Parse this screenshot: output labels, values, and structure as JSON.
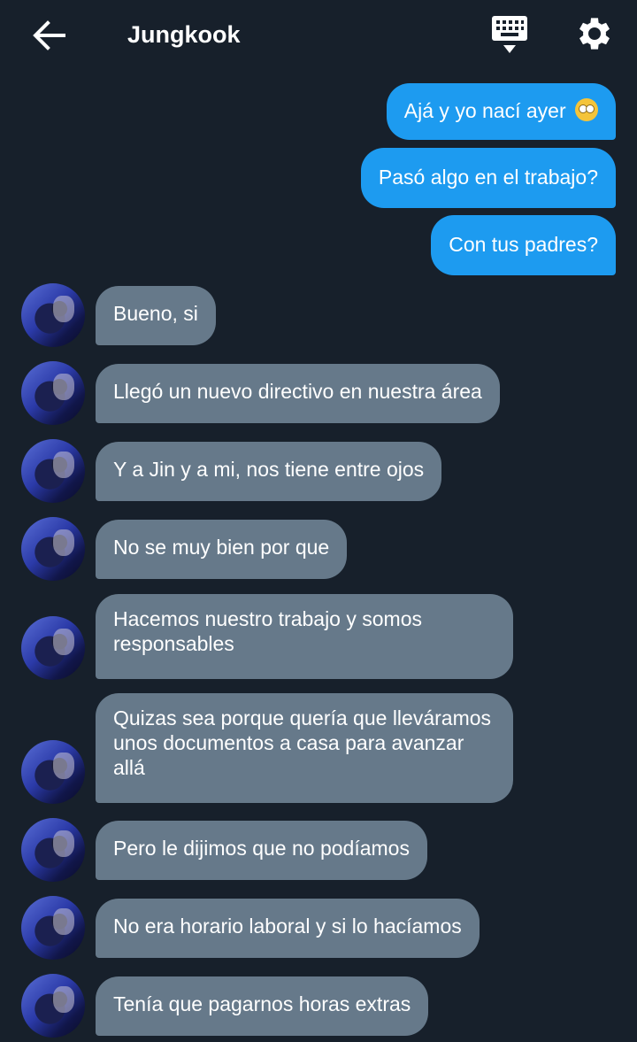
{
  "header": {
    "title": "Jungkook",
    "back_icon": "arrow-left-icon",
    "keyboard_icon": "keyboard-icon",
    "settings_icon": "gear-icon"
  },
  "colors": {
    "background": "#17202b",
    "outgoing_bubble": "#1d9bf0",
    "incoming_bubble": "#66798a"
  },
  "messages_out": [
    {
      "text": "Ajá y yo nací ayer",
      "emoji": "face-with-rolling-eyes"
    },
    {
      "text": "Pasó algo en el trabajo?"
    },
    {
      "text": "Con tus padres?"
    }
  ],
  "messages_in": [
    {
      "text": "Bueno, si"
    },
    {
      "text": "Llegó un nuevo directivo en nuestra área"
    },
    {
      "text": "Y a Jin y a mi, nos tiene entre ojos"
    },
    {
      "text": "No se muy bien por que"
    },
    {
      "text": "Hacemos nuestro trabajo y somos responsables"
    },
    {
      "text": "Quizas sea porque quería que lleváramos unos documentos a casa para avanzar allá"
    },
    {
      "text": "Pero le dijimos que no podíamos"
    },
    {
      "text": "No era horario laboral y si lo hacíamos"
    },
    {
      "text": "Tenía que pagarnos horas extras"
    }
  ]
}
